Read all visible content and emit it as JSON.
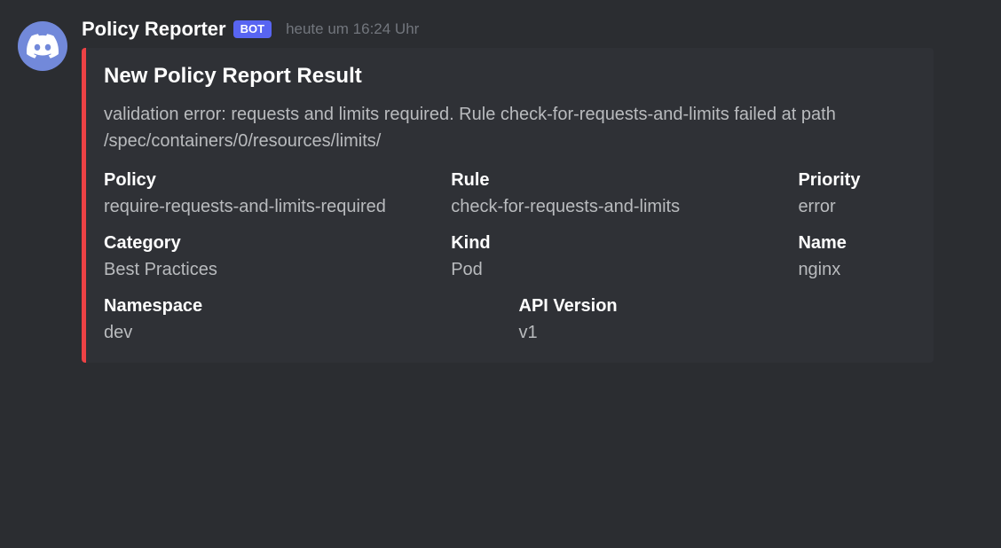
{
  "author": {
    "name": "Policy Reporter",
    "bot_badge": "BOT",
    "timestamp": "heute um 16:24 Uhr"
  },
  "embed": {
    "accent_color": "#ed4245",
    "title": "New Policy Report Result",
    "description": "validation error: requests and limits required. Rule check-for-requests-and-limits failed at path /spec/containers/0/resources/limits/",
    "fields": {
      "policy": {
        "name": "Policy",
        "value": "require-requests-and-limits-required"
      },
      "rule": {
        "name": "Rule",
        "value": "check-for-requests-and-limits"
      },
      "priority": {
        "name": "Priority",
        "value": "error"
      },
      "category": {
        "name": "Category",
        "value": "Best Practices"
      },
      "kind": {
        "name": "Kind",
        "value": "Pod"
      },
      "resource_name": {
        "name": "Name",
        "value": "nginx"
      },
      "namespace": {
        "name": "Namespace",
        "value": "dev"
      },
      "api_version": {
        "name": "API Version",
        "value": "v1"
      }
    }
  }
}
